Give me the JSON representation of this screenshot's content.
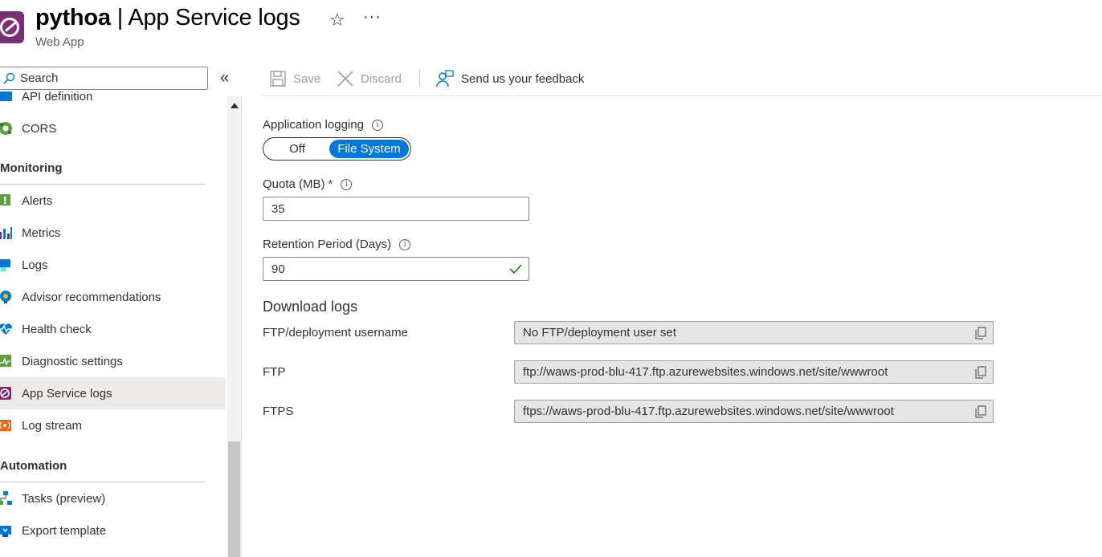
{
  "header": {
    "resource_name": "pythoa",
    "separator": " | ",
    "page_name": "App Service logs",
    "subtitle": "Web App",
    "favorite_icon": "☆",
    "more_icon": "···"
  },
  "sidebar": {
    "search_placeholder": "Search",
    "collapse_icon": "«",
    "partial_item": "API definition",
    "items_top": [
      {
        "label": "CORS",
        "icon": "cors-icon"
      }
    ],
    "groups": [
      {
        "title": "Monitoring",
        "items": [
          {
            "label": "Alerts",
            "icon": "alerts-icon"
          },
          {
            "label": "Metrics",
            "icon": "metrics-icon"
          },
          {
            "label": "Logs",
            "icon": "logs-icon"
          },
          {
            "label": "Advisor recommendations",
            "icon": "advisor-icon"
          },
          {
            "label": "Health check",
            "icon": "health-check-icon"
          },
          {
            "label": "Diagnostic settings",
            "icon": "diagnostic-settings-icon"
          },
          {
            "label": "App Service logs",
            "icon": "app-service-logs-icon",
            "selected": true
          },
          {
            "label": "Log stream",
            "icon": "log-stream-icon"
          }
        ]
      },
      {
        "title": "Automation",
        "items": [
          {
            "label": "Tasks (preview)",
            "icon": "tasks-icon"
          },
          {
            "label": "Export template",
            "icon": "export-template-icon"
          }
        ]
      }
    ]
  },
  "toolbar": {
    "save_label": "Save",
    "discard_label": "Discard",
    "feedback_label": "Send us your feedback"
  },
  "form": {
    "app_logging": {
      "label": "Application logging",
      "options": [
        "Off",
        "File System"
      ],
      "selected": "File System"
    },
    "quota": {
      "label": "Quota (MB)",
      "required_mark": "*",
      "value": "35"
    },
    "retention": {
      "label": "Retention Period (Days)",
      "value": "90"
    },
    "download": {
      "title": "Download logs",
      "rows": [
        {
          "label": "FTP/deployment username",
          "value": "No FTP/deployment user set"
        },
        {
          "label": "FTP",
          "value": "ftp://waws-prod-blu-417.ftp.azurewebsites.windows.net/site/wwwroot"
        },
        {
          "label": "FTPS",
          "value": "ftps://waws-prod-blu-417.ftp.azurewebsites.windows.net/site/wwwroot"
        }
      ]
    }
  },
  "colors": {
    "accent": "#0078d4",
    "selected_bg": "#edebe9",
    "readonly_bg": "#e5e5e5",
    "success": "#107c10",
    "required": "#a4262c"
  }
}
